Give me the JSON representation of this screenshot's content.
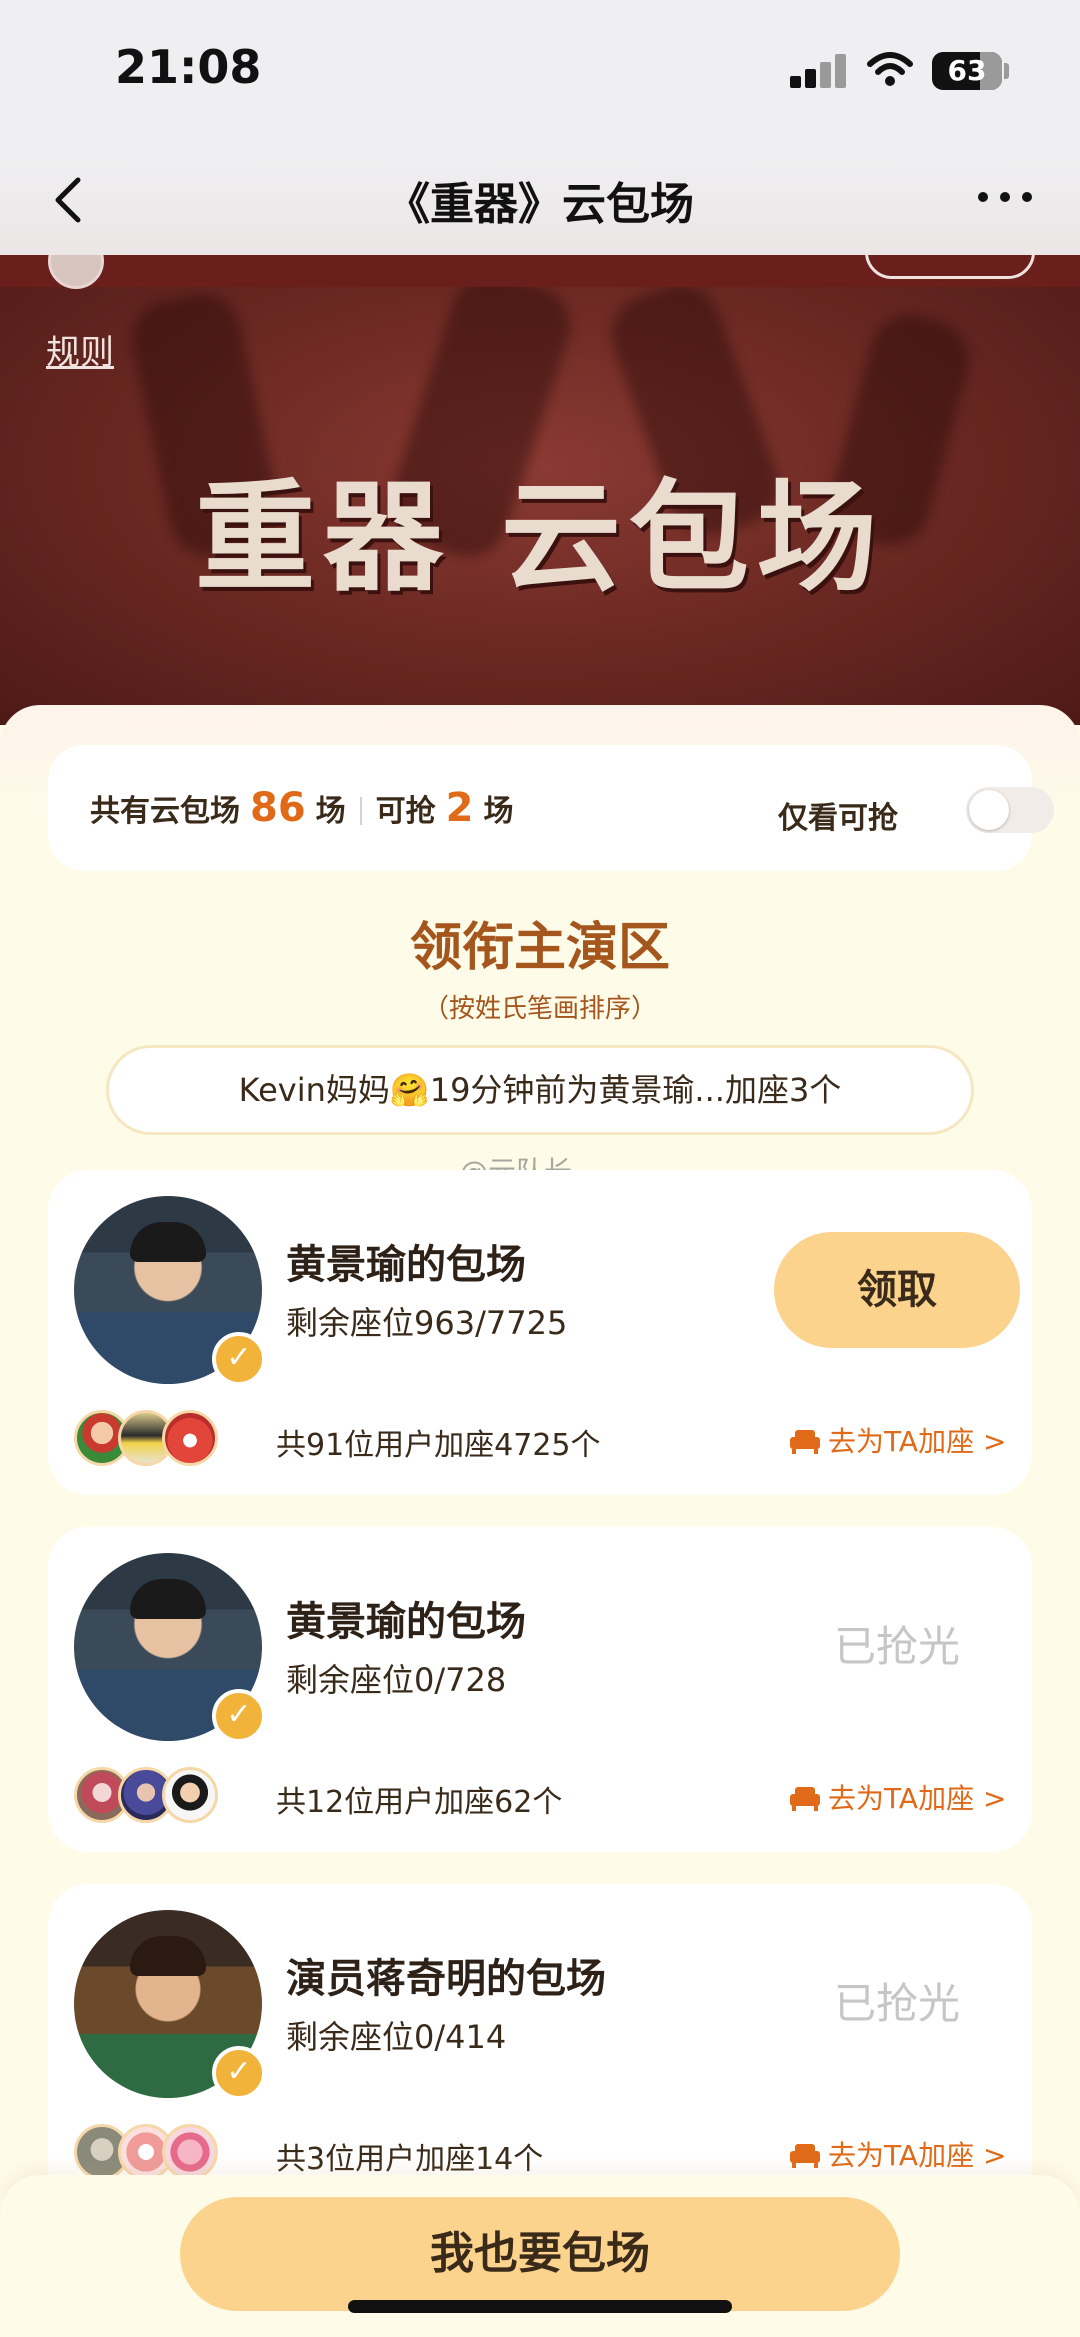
{
  "status": {
    "time": "21:08",
    "battery": "63"
  },
  "nav": {
    "title": "《重器》云包场"
  },
  "banner": {
    "rule_link": "规则",
    "title": "重器 云包场"
  },
  "summary": {
    "prefix": "共有云包场",
    "total": "86",
    "unit1": "场",
    "grab_prefix": "可抢",
    "grabbable": "2",
    "unit2": "场",
    "toggle_label": "仅看可抢",
    "toggle_on": false
  },
  "section": {
    "title": "领衔主演区",
    "subtitle": "（按姓氏笔画排序）"
  },
  "ticker": "Kevin妈妈🤗19分钟前为黄景瑜...加座3个",
  "watermark": "@元队长",
  "cards": [
    {
      "name": "黄景瑜的包场",
      "seats": "剩余座位963/7725",
      "action": "领取",
      "joined": "共91位用户加座4725个",
      "add_link": "去为TA加座 >"
    },
    {
      "name": "黄景瑜的包场",
      "seats": "剩余座位0/728",
      "action": "已抢光",
      "joined": "共12位用户加座62个",
      "add_link": "去为TA加座 >"
    },
    {
      "name": "演员蒋奇明的包场",
      "seats": "剩余座位0/414",
      "action": "已抢光",
      "joined": "共3位用户加座14个",
      "add_link": "去为TA加座 >"
    }
  ],
  "verified_mark": "✓",
  "cta": "我也要包场",
  "colors": {
    "accent": "#e06a18",
    "button": "#fbd38d",
    "section_title": "#a4561c",
    "banner": "#6e2a24"
  }
}
